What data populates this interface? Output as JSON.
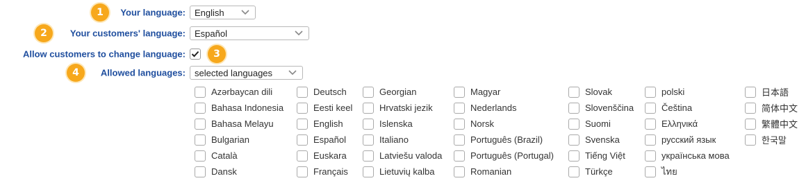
{
  "settings": {
    "your_language": {
      "badge": "1",
      "label": "Your language:",
      "value": "English"
    },
    "customers_language": {
      "badge": "2",
      "label": "Your customers' language:",
      "value": "Español"
    },
    "allow_change": {
      "badge": "3",
      "label": "Allow customers to change language:",
      "checked": true
    },
    "allowed_languages": {
      "badge": "4",
      "label": "Allowed languages:",
      "value": "selected languages"
    }
  },
  "languages": [
    [
      "Azərbaycan dili",
      "Bahasa Indonesia",
      "Bahasa Melayu",
      "Bulgarian",
      "Català",
      "Dansk"
    ],
    [
      "Deutsch",
      "Eesti keel",
      "English",
      "Español",
      "Euskara",
      "Français"
    ],
    [
      "Georgian",
      "Hrvatski jezik",
      "Islenska",
      "Italiano",
      "Latviešu valoda",
      "Lietuvių kalba"
    ],
    [
      "Magyar",
      "Nederlands",
      "Norsk",
      "Português (Brazil)",
      "Português (Portugal)",
      "Romanian"
    ],
    [
      "Slovak",
      "Slovenščina",
      "Suomi",
      "Svenska",
      "Tiếng Việt",
      "Türkçe"
    ],
    [
      "polski",
      "Čeština",
      "Ελληνικά",
      "русский язык",
      "українська мова",
      "ไทย"
    ],
    [
      "日本語",
      "简体中文",
      "繁體中文",
      "한국말"
    ]
  ],
  "colors": {
    "label": "#1f4e9e",
    "badge": "#f7a81c"
  }
}
